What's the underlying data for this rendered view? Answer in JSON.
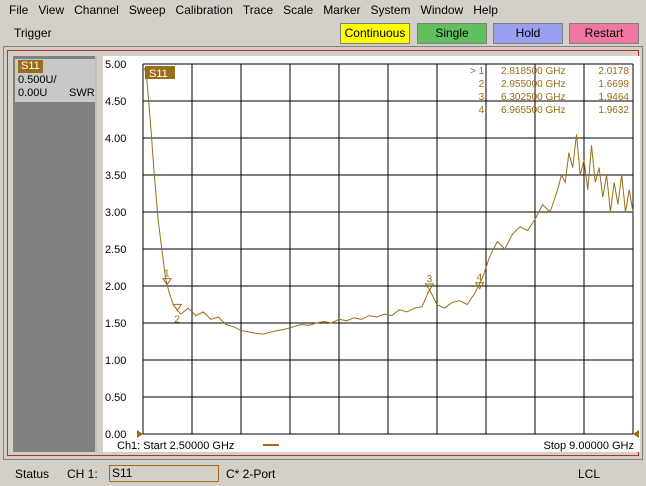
{
  "menu": [
    "File",
    "View",
    "Channel",
    "Sweep",
    "Calibration",
    "Trace",
    "Scale",
    "Marker",
    "System",
    "Window",
    "Help"
  ],
  "toolbar": {
    "trigger": "Trigger",
    "continuous": "Continuous",
    "single": "Single",
    "hold": "Hold",
    "restart": "Restart"
  },
  "colors": {
    "continuous": "#ffff00",
    "single": "#60c060",
    "hold": "#9aa0f0",
    "restart": "#f078a0",
    "trace": "#9a6e18"
  },
  "trace_box": {
    "name": "S11",
    "scale": "0.500U/",
    "ref": "0.00U",
    "format": "SWR"
  },
  "plot": {
    "trace_tag": "S11",
    "start": "Ch1: Start  2.50000 GHz",
    "stop": "Stop  9.00000 GHz"
  },
  "markers": [
    {
      "label": "> 1:",
      "freq": "2.818500 GHz",
      "value": "2.0178"
    },
    {
      "label": "2:",
      "freq": "2.955000 GHz",
      "value": "1.6699"
    },
    {
      "label": "3:",
      "freq": "6.302500 GHz",
      "value": "1.9464"
    },
    {
      "label": "4:",
      "freq": "6.965500 GHz",
      "value": "1.9632"
    }
  ],
  "status": {
    "label": "Status",
    "channel": "CH 1:",
    "trace": "S11",
    "cal": "C* 2-Port",
    "mode": "LCL"
  },
  "chart_data": {
    "type": "line",
    "xlabel": "",
    "ylabel": "",
    "xlim": [
      2.5,
      9.0
    ],
    "ylim": [
      0,
      5
    ],
    "yticks": [
      "5.00",
      "4.50",
      "4.00",
      "3.50",
      "3.00",
      "2.50",
      "2.00",
      "1.50",
      "1.00",
      "0.50",
      "0.00"
    ],
    "grid": true,
    "series": [
      {
        "name": "S11",
        "x": [
          2.52,
          2.55,
          2.6,
          2.65,
          2.7,
          2.75,
          2.8,
          2.85,
          2.9,
          2.95,
          3.0,
          3.1,
          3.2,
          3.3,
          3.4,
          3.5,
          3.6,
          3.7,
          3.8,
          3.9,
          4.0,
          4.1,
          4.2,
          4.3,
          4.4,
          4.5,
          4.6,
          4.7,
          4.8,
          4.9,
          5.0,
          5.1,
          5.2,
          5.3,
          5.4,
          5.5,
          5.6,
          5.7,
          5.8,
          5.9,
          6.0,
          6.1,
          6.2,
          6.3,
          6.4,
          6.5,
          6.6,
          6.7,
          6.8,
          6.9,
          7.0,
          7.1,
          7.2,
          7.3,
          7.4,
          7.5,
          7.6,
          7.7,
          7.8,
          7.9,
          8.0,
          8.05,
          8.1,
          8.15,
          8.2,
          8.25,
          8.3,
          8.35,
          8.4,
          8.45,
          8.5,
          8.55,
          8.6,
          8.65,
          8.7,
          8.75,
          8.8,
          8.85,
          8.9,
          8.95,
          9.0
        ],
        "y": [
          4.95,
          4.8,
          4.2,
          3.5,
          2.9,
          2.5,
          2.1,
          1.9,
          1.75,
          1.68,
          1.62,
          1.7,
          1.6,
          1.65,
          1.55,
          1.58,
          1.48,
          1.45,
          1.4,
          1.38,
          1.36,
          1.35,
          1.38,
          1.4,
          1.42,
          1.45,
          1.48,
          1.47,
          1.5,
          1.52,
          1.5,
          1.55,
          1.53,
          1.57,
          1.55,
          1.6,
          1.58,
          1.62,
          1.6,
          1.68,
          1.65,
          1.7,
          1.72,
          1.95,
          1.75,
          1.7,
          1.78,
          1.8,
          1.75,
          1.9,
          2.1,
          2.4,
          2.6,
          2.5,
          2.7,
          2.8,
          2.75,
          2.9,
          3.1,
          3.0,
          3.3,
          3.5,
          3.4,
          3.8,
          3.6,
          4.05,
          3.5,
          3.7,
          3.3,
          3.9,
          3.4,
          3.6,
          3.2,
          3.5,
          3.0,
          3.4,
          3.1,
          3.5,
          3.0,
          3.3,
          3.0
        ]
      }
    ],
    "marker_points": [
      {
        "id": "1",
        "x": 2.8185,
        "y": 2.0178
      },
      {
        "id": "2",
        "x": 2.955,
        "y": 1.6699
      },
      {
        "id": "3",
        "x": 6.3025,
        "y": 1.9464
      },
      {
        "id": "4",
        "x": 6.9655,
        "y": 1.9632
      }
    ]
  }
}
